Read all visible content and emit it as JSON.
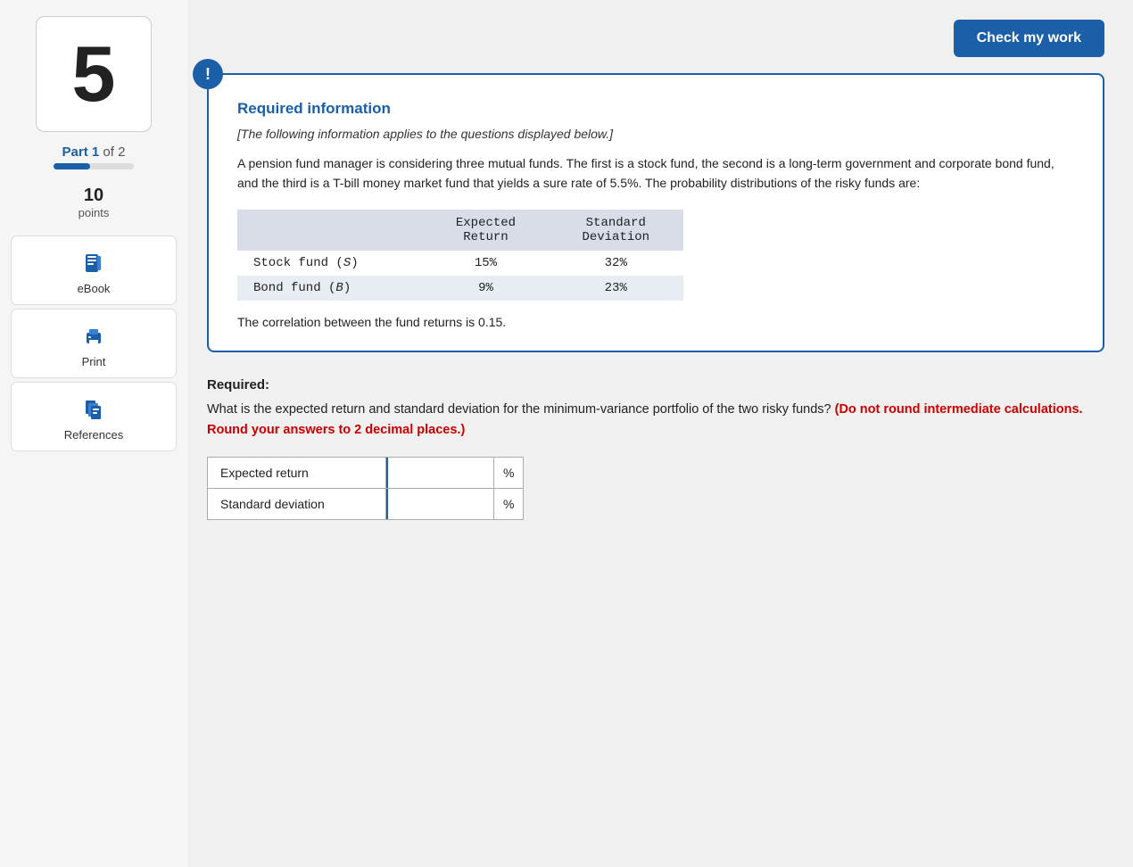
{
  "page": {
    "question_number": "5",
    "part_label": "Part 1",
    "part_of": "of 2",
    "progress_percent": 45,
    "points_number": "10",
    "points_label": "points"
  },
  "toolbar": {
    "check_my_work_label": "Check my work"
  },
  "sidebar": {
    "ebook_label": "eBook",
    "print_label": "Print",
    "references_label": "References"
  },
  "info_box": {
    "icon": "!",
    "title": "Required information",
    "subtitle": "[The following information applies to the questions displayed below.]",
    "body": "A pension fund manager is considering three mutual funds. The first is a stock fund, the second is a long-term government and corporate bond fund, and the third is a T-bill money market fund that yields a sure rate of 5.5%. The probability distributions of the risky funds are:",
    "table": {
      "col1": "",
      "col2_header1": "Expected",
      "col2_header2": "Return",
      "col3_header1": "Standard",
      "col3_header2": "Deviation",
      "rows": [
        {
          "fund": "Stock fund (S)",
          "expected_return": "15%",
          "std_dev": "32%"
        },
        {
          "fund": "Bond fund (B)",
          "expected_return": "9%",
          "std_dev": "23%"
        }
      ]
    },
    "correlation_text": "The correlation between the fund returns is 0.15."
  },
  "required_section": {
    "label": "Required:",
    "text": "What is the expected return and standard deviation for the minimum-variance portfolio of the two risky funds?",
    "warning": "(Do not round intermediate calculations. Round your answers to 2 decimal places.)"
  },
  "answer_inputs": {
    "expected_return_label": "Expected return",
    "expected_return_placeholder": "",
    "expected_return_unit": "%",
    "std_dev_label": "Standard deviation",
    "std_dev_placeholder": "",
    "std_dev_unit": "%"
  }
}
